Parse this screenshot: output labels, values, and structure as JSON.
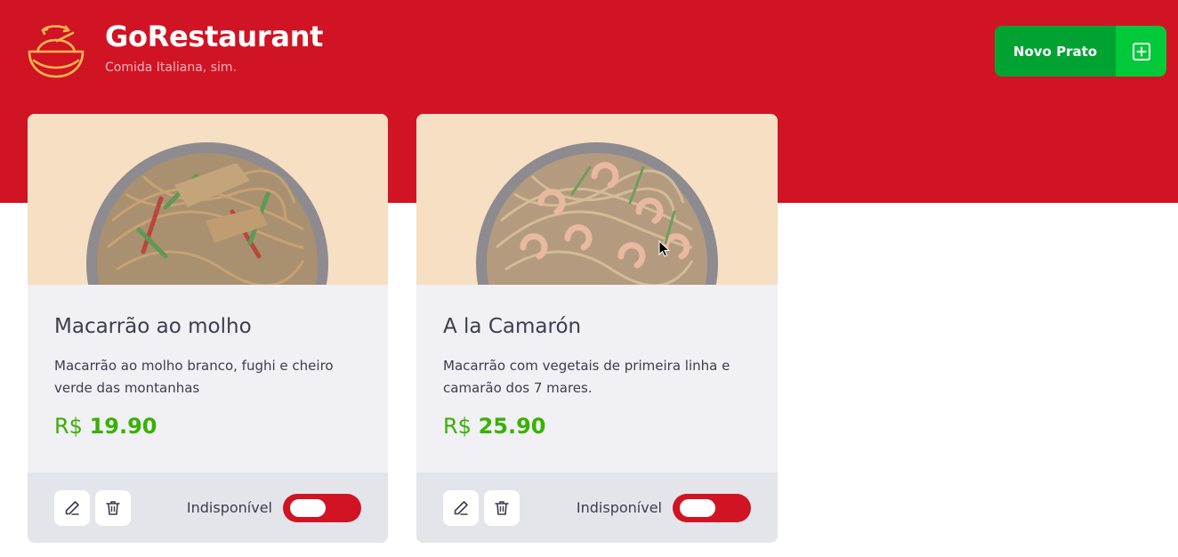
{
  "header": {
    "logo_icon": "bowl-icon",
    "title": "GoRestaurant",
    "subtitle": "Comida Italiana, sim.",
    "new_dish_button": {
      "label": "Novo Prato",
      "icon": "plus-square-icon"
    },
    "background_color": "#d01424"
  },
  "dishes": [
    {
      "name": "Macarrão ao molho",
      "description": "Macarrão ao molho branco, fughi e cheiro verde das montanhas",
      "currency": "R$",
      "price": "19.90",
      "edit_icon": "pencil-icon",
      "delete_icon": "trash-icon",
      "availability_label": "Indisponível",
      "available": false
    },
    {
      "name": "A la Camarón",
      "description": "Macarrão com vegetais de primeira linha e camarão dos 7 mares.",
      "currency": "R$",
      "price": "25.90",
      "edit_icon": "pencil-icon",
      "delete_icon": "trash-icon",
      "availability_label": "Indisponível",
      "available": false
    }
  ],
  "colors": {
    "brand_red": "#d01424",
    "button_green": "#00a331",
    "button_green_light": "#00c93a",
    "price_green": "#39b100",
    "card_bg": "#f0f0f5",
    "footer_bg": "#e4e4eb",
    "image_bg": "#f6dfc2"
  }
}
